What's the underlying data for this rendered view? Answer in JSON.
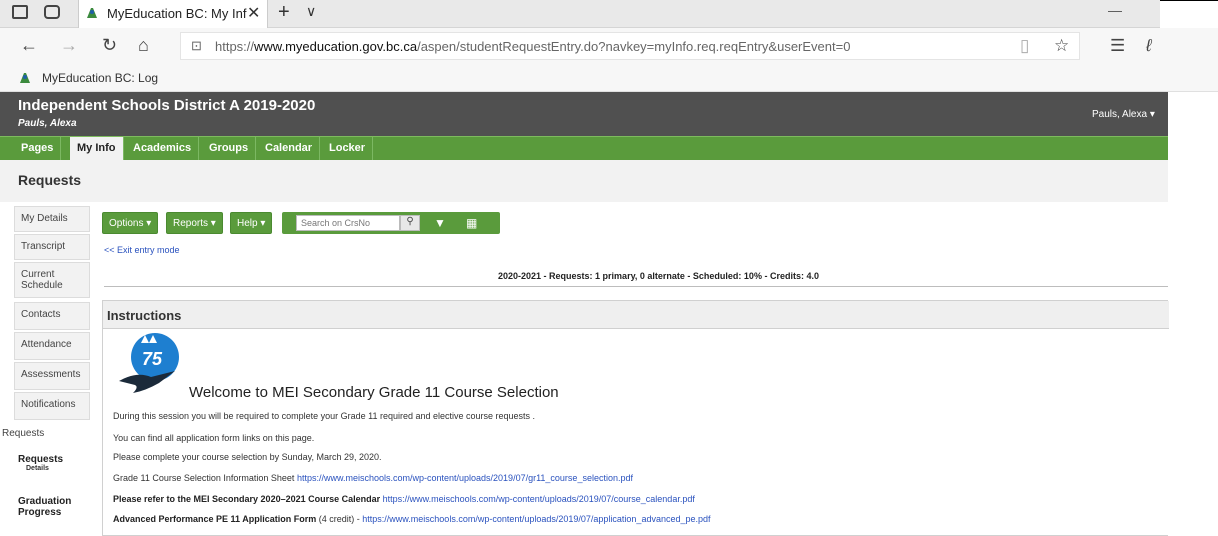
{
  "browser": {
    "tab_title": "MyEducation BC: My Inf",
    "url_prefix": "https://",
    "url_domain": "www.myeducation.gov.bc.ca",
    "url_path": "/aspen/studentRequestEntry.do?navkey=myInfo.req.reqEntry&userEvent=0",
    "favorite_label": "MyEducation BC: Log"
  },
  "header": {
    "district": "Independent Schools District A 2019-2020",
    "student": "Pauls, Alexa",
    "user_menu": "Pauls, Alexa ▾"
  },
  "nav_tabs": [
    "Pages",
    "My Info",
    "Academics",
    "Groups",
    "Calendar",
    "Locker"
  ],
  "page_title": "Requests",
  "side_nav": {
    "items": [
      "My Details",
      "Transcript",
      "Current Schedule",
      "Contacts",
      "Attendance",
      "Assessments",
      "Notifications"
    ],
    "section_label": "Requests",
    "active_item": "Requests",
    "active_sub": "Details",
    "next_item": "Graduation Progress"
  },
  "toolbar": {
    "options": "Options ▾",
    "reports": "Reports ▾",
    "help": "Help ▾",
    "search_placeholder": "Search on CrsNo"
  },
  "exit_link": "<< Exit entry mode",
  "summary": "2020-2021 - Requests: 1 primary, 0 alternate - Scheduled: 10% - Credits: 4.0",
  "instructions": {
    "heading": "Instructions",
    "logo_text": "75",
    "welcome": "Welcome to MEI Secondary Grade 11 Course Selection",
    "lines": [
      "During this session you will be required to complete your Grade 11 required and elective course requests .",
      "You can find all application form links on this page.",
      "Please complete your course selection by Sunday, March 29, 2020."
    ],
    "info_sheet_label": "Grade 11 Course Selection Information Sheet",
    "info_sheet_url": "https://www.meischools.com/wp-content/uploads/2019/07/gr11_course_selection.pdf",
    "calendar_label": "Please refer to the MEI Secondary 2020–2021 Course Calendar",
    "calendar_url": "https://www.meischools.com/wp-content/uploads/2019/07/course_calendar.pdf",
    "pe_label": "Advanced Performance PE 11 Application Form",
    "pe_credit": "(4 credit) -",
    "pe_url": "https://www.meischools.com/wp-content/uploads/2019/07/application_advanced_pe.pdf"
  },
  "colors": {
    "header_gray": "#505050",
    "nav_green": "#5a9b3c",
    "link_blue": "#2a52be"
  }
}
